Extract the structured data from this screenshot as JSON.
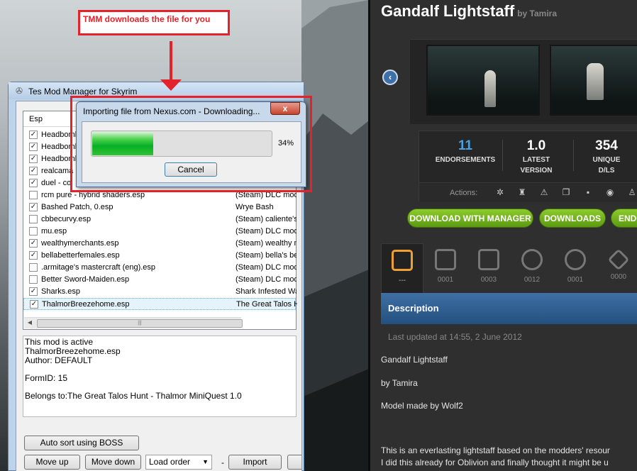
{
  "annotation": {
    "label": "TMM downloads the file for you"
  },
  "tmm_window": {
    "title": "Tes Mod Manager for Skyrim",
    "columns": {
      "esp": "Esp",
      "belongs_to": ""
    },
    "plugins": [
      {
        "name": "Headbomb",
        "owner": "",
        "checked": true
      },
      {
        "name": "Headbomb",
        "owner": "",
        "checked": true
      },
      {
        "name": "Headbomb",
        "owner": "",
        "checked": true
      },
      {
        "name": "realcama",
        "owner": "",
        "checked": true
      },
      {
        "name": "duel - co",
        "owner": "",
        "checked": true
      },
      {
        "name": "rcm pure - hybrid shaders.esp",
        "owner": "(Steam) DLC mod",
        "checked": false
      },
      {
        "name": "Bashed Patch, 0.esp",
        "owner": "Wrye Bash",
        "checked": true
      },
      {
        "name": "cbbecurvy.esp",
        "owner": "(Steam) caliente's b",
        "checked": false
      },
      {
        "name": "mu.esp",
        "owner": "(Steam) DLC mod",
        "checked": false
      },
      {
        "name": "wealthymerchants.esp",
        "owner": "(Steam) wealthy mer",
        "checked": true
      },
      {
        "name": "bellabetterfemales.esp",
        "owner": "(Steam) bella's bette",
        "checked": true
      },
      {
        "name": ".armitage's mastercraft (eng).esp",
        "owner": "(Steam) DLC mod",
        "checked": false
      },
      {
        "name": "Better Sword-Maiden.esp",
        "owner": "(Steam) DLC mod",
        "checked": false
      },
      {
        "name": "Sharks.esp",
        "owner": "Shark Infested Wate",
        "checked": true
      },
      {
        "name": "ThalmorBreezehome.esp",
        "owner": "The Great Talos Hu",
        "checked": true
      }
    ],
    "info": {
      "line1": "This mod is active",
      "line2": "ThalmorBreezehome.esp",
      "line3": "Author: DEFAULT",
      "line4": "FormID: 15",
      "line5": "Belongs to:The Great Talos Hunt - Thalmor MiniQuest 1.0"
    },
    "buttons": {
      "auto_sort": "Auto sort using BOSS",
      "move_up": "Move up",
      "move_down": "Move down",
      "import": "Import",
      "dash": "-"
    },
    "load_order_select": "Load order"
  },
  "dialog": {
    "title": "Importing file from Nexus.com - Downloading...",
    "close": "x",
    "progress": 0.34,
    "progress_label": "34%",
    "cancel": "Cancel"
  },
  "site": {
    "title": "Gandalf Lightstaff",
    "by": "by Tamira",
    "stats": [
      {
        "value": "11",
        "label1": "ENDORSEMENTS",
        "label2": ""
      },
      {
        "value": "1.0",
        "label1": "LATEST",
        "label2": "VERSION"
      },
      {
        "value": "354",
        "label1": "UNIQUE",
        "label2": "D/LS"
      }
    ],
    "actions_label": "Actions:",
    "buttons": {
      "download_manager": "DOWNLOAD WITH MANAGER",
      "downloads": "DOWNLOADS",
      "endorse": "ENDO"
    },
    "tabs": [
      "---",
      "0001",
      "0003",
      "0012",
      "0001",
      "0000"
    ],
    "description_heading": "Description",
    "updated": "Last updated at 14:55, 2 June 2012",
    "body": {
      "p1": "Gandalf Lightstaff",
      "p2": "by Tamira",
      "p3": "Model made by Wolf2",
      "p4": "This is an everlasting lightstaff based on the modders' resour",
      "p5": "I did this already for Oblivion and finally thought it might be u"
    },
    "accent_green": "#6fb01e",
    "accent_blue": "#2f5f93",
    "stat_blue": "#4aa3e0"
  }
}
